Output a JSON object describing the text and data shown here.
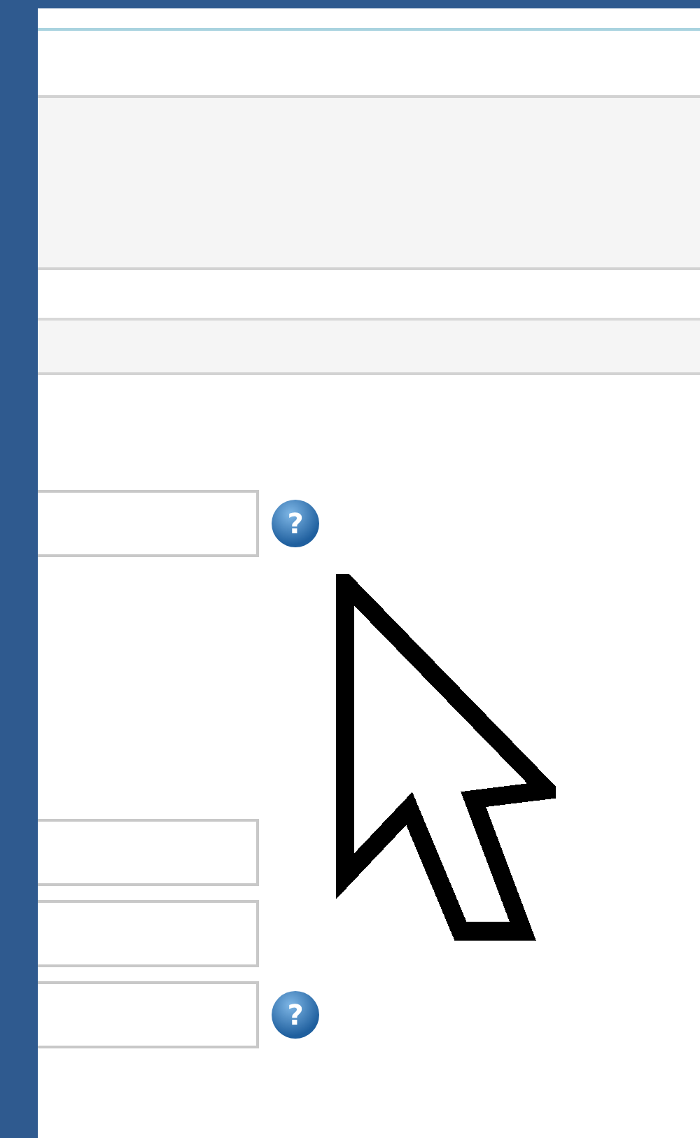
{
  "field_groups": [
    [
      {
        "has_help": true,
        "help": "?"
      }
    ],
    [
      {
        "has_help": false
      },
      {
        "has_help": false
      },
      {
        "has_help": true,
        "help": "?"
      }
    ]
  ]
}
